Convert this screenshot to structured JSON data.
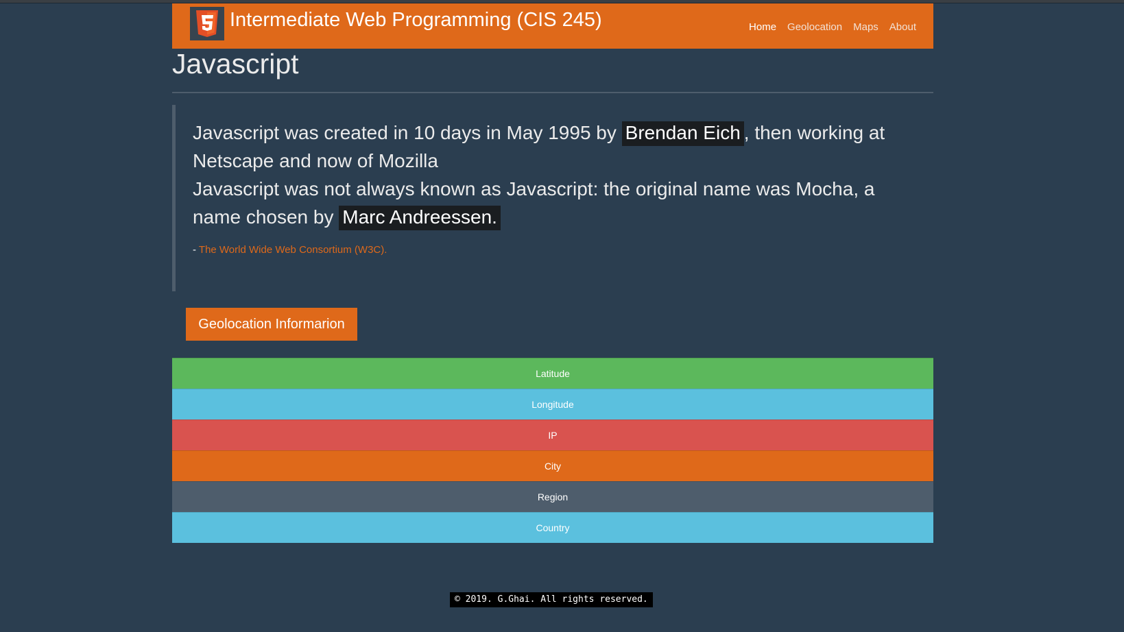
{
  "header": {
    "title": "Intermediate Web Programming (CIS 245)",
    "logo_icon": "html5-logo-icon",
    "nav": [
      {
        "label": "Home",
        "active": true
      },
      {
        "label": "Geolocation",
        "active": false
      },
      {
        "label": "Maps",
        "active": false
      },
      {
        "label": "About",
        "active": false
      }
    ]
  },
  "main": {
    "page_title": "Javascript",
    "quote": {
      "line1_pre": "Javascript was created in 10 days in May 1995 by ",
      "line1_name": "Brendan Eich",
      "line1_post": ", then working at Netscape and now of Mozilla",
      "line2_pre": "Javascript was not always known as Javascript: the original name was Mocha, a name chosen by ",
      "line2_name": "Marc Andreessen.",
      "source_dash": "-",
      "source_link": "The World Wide Web Consortium (W3C)."
    },
    "geo_button_label": "Geolocation Informarion",
    "info_rows": [
      {
        "label": "Latitude",
        "color": "#5cb85c"
      },
      {
        "label": "Longitude",
        "color": "#5bc0de"
      },
      {
        "label": "IP",
        "color": "#d9534f"
      },
      {
        "label": "City",
        "color": "#df691a"
      },
      {
        "label": "Region",
        "color": "#4e5d6c"
      },
      {
        "label": "Country",
        "color": "#5bc0de"
      }
    ]
  },
  "footer": {
    "text": "© 2019. G.Ghai. All rights reserved."
  },
  "colors": {
    "background": "#2b3e50",
    "accent": "#df691a",
    "highlight_bg": "#1a1d20"
  }
}
